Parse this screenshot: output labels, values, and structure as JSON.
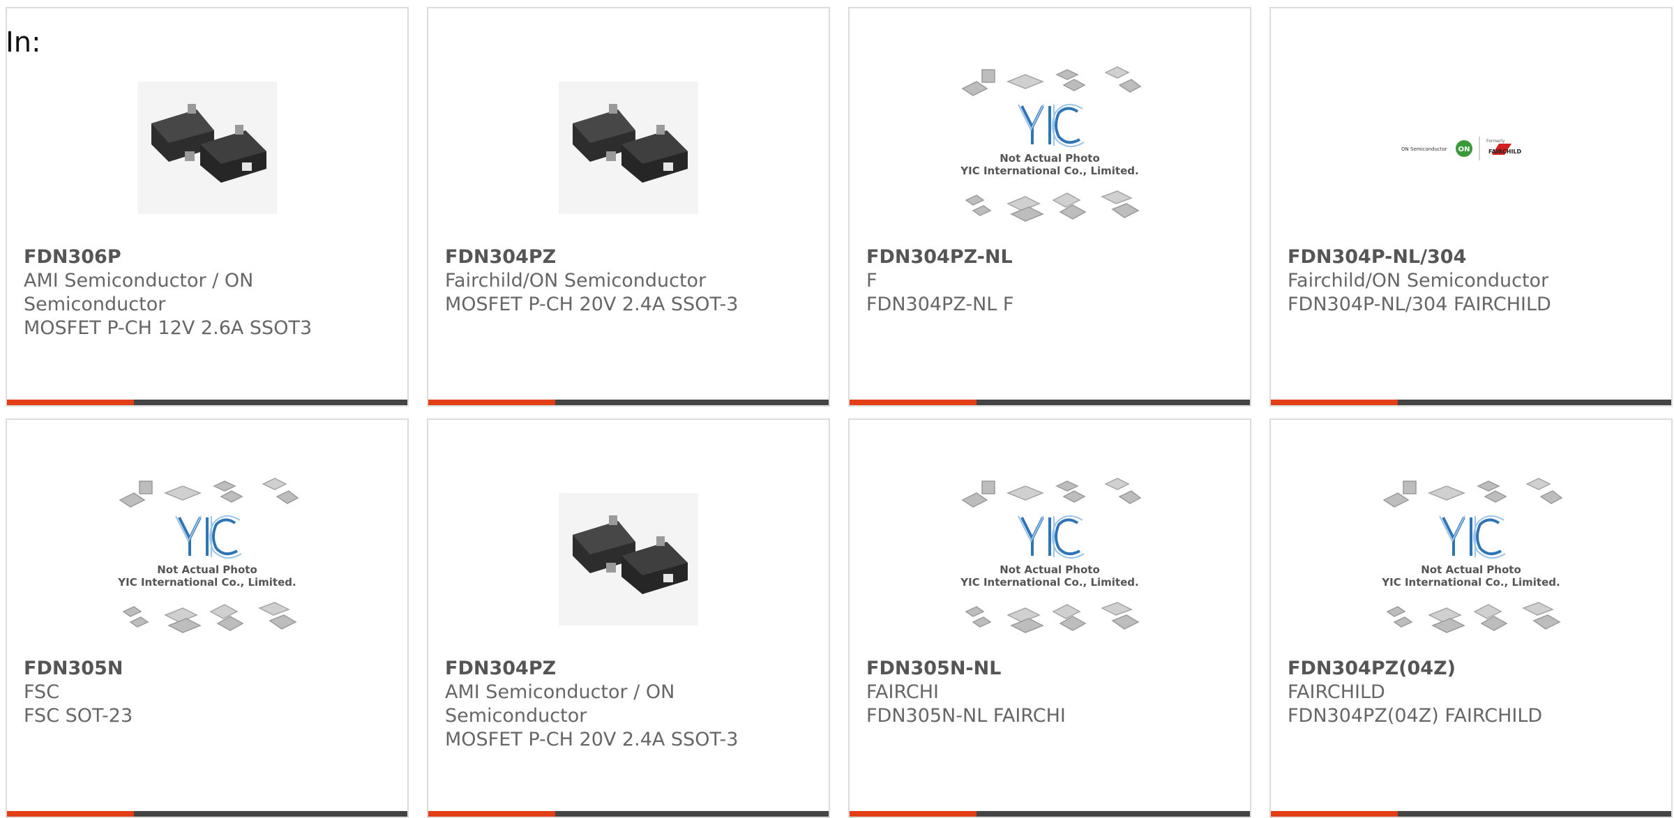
{
  "label": "In:",
  "placeholder": {
    "line1": "Not Actual Photo",
    "line2": "YIC International Co., Limited."
  },
  "brand_logo": {
    "on_semi": "ON Semiconductor",
    "formerly": "Formerly",
    "fairchild": "FAIRCHILD"
  },
  "colors": {
    "accent": "#e23f17",
    "bar": "#444444",
    "border": "#dcdcdc"
  },
  "products": [
    {
      "part": "FDN306P",
      "manufacturer": "AMI Semiconductor / ON Semiconductor",
      "description": "MOSFET P-CH 12V 2.6A SSOT3",
      "image": "sot23-photo"
    },
    {
      "part": "FDN304PZ",
      "manufacturer": "Fairchild/ON Semiconductor",
      "description": "MOSFET P-CH 20V 2.4A SSOT-3",
      "image": "sot23-photo"
    },
    {
      "part": "FDN304PZ-NL",
      "manufacturer": "F",
      "description": "FDN304PZ-NL F",
      "image": "yic-placeholder"
    },
    {
      "part": "FDN304P-NL/304",
      "manufacturer": "Fairchild/ON Semiconductor",
      "description": "FDN304P-NL/304 FAIRCHILD",
      "image": "brand-logo"
    },
    {
      "part": "FDN305N",
      "manufacturer": "FSC",
      "description": "FSC SOT-23",
      "image": "yic-placeholder"
    },
    {
      "part": "FDN304PZ",
      "manufacturer": "AMI Semiconductor / ON Semiconductor",
      "description": "MOSFET P-CH 20V 2.4A SSOT-3",
      "image": "sot23-photo"
    },
    {
      "part": "FDN305N-NL",
      "manufacturer": "FAIRCHI",
      "description": "FDN305N-NL FAIRCHI",
      "image": "yic-placeholder"
    },
    {
      "part": "FDN304PZ(04Z)",
      "manufacturer": "FAIRCHILD",
      "description": "FDN304PZ(04Z) FAIRCHILD",
      "image": "yic-placeholder"
    }
  ]
}
